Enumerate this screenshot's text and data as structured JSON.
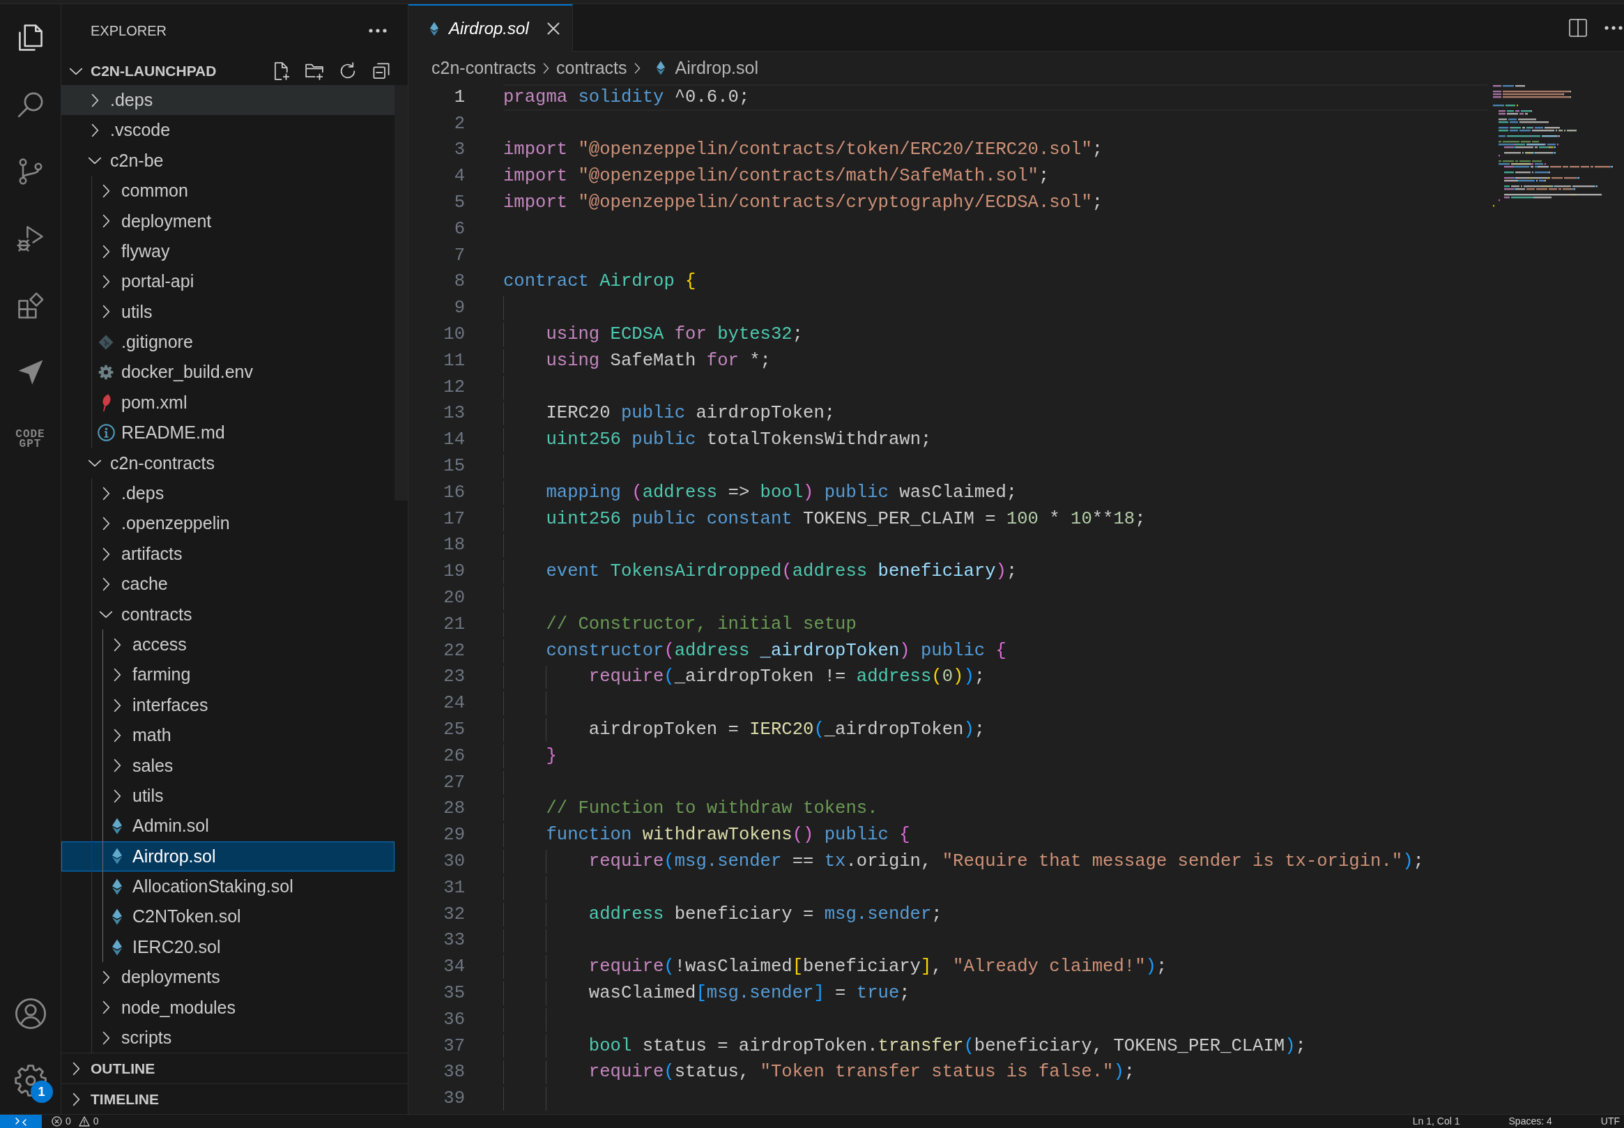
{
  "activity_bar": {
    "items": [
      {
        "kind": "explorer",
        "selected": true
      },
      {
        "kind": "search",
        "selected": false
      },
      {
        "kind": "source-control",
        "selected": false
      },
      {
        "kind": "run-debug",
        "selected": false
      },
      {
        "kind": "extensions",
        "selected": false
      },
      {
        "kind": "send",
        "selected": false
      },
      {
        "kind": "text-logo",
        "label": "CODE GPT",
        "selected": false
      }
    ],
    "bottom_items": [
      {
        "kind": "account"
      },
      {
        "kind": "settings",
        "badge": "1"
      }
    ]
  },
  "sidebar": {
    "title": "EXPLORER",
    "sections": [
      {
        "title": "C2N-LAUNCHPAD",
        "kind": "workspace",
        "expanded": true,
        "tree": [
          {
            "label": ".deps",
            "kind": "folder",
            "expanded": false,
            "hovered": true,
            "selected": false
          },
          {
            "label": ".vscode",
            "kind": "folder",
            "expanded": false,
            "hovered": false,
            "selected": false
          },
          {
            "label": "c2n-be",
            "kind": "folder",
            "expanded": true,
            "hovered": false,
            "selected": false,
            "children": [
              {
                "label": "common",
                "kind": "folder",
                "expanded": false,
                "hovered": false,
                "selected": false
              },
              {
                "label": "deployment",
                "kind": "folder",
                "expanded": false,
                "hovered": false,
                "selected": false
              },
              {
                "label": "flyway",
                "kind": "folder",
                "expanded": false,
                "hovered": false,
                "selected": false
              },
              {
                "label": "portal-api",
                "kind": "folder",
                "expanded": false,
                "hovered": false,
                "selected": false
              },
              {
                "label": "utils",
                "kind": "folder",
                "expanded": false,
                "hovered": false,
                "selected": false
              },
              {
                "label": ".gitignore",
                "kind": "gitignore",
                "hovered": false,
                "selected": false
              },
              {
                "label": "docker_build.env",
                "kind": "env",
                "hovered": false,
                "selected": false
              },
              {
                "label": "pom.xml",
                "kind": "xml",
                "hovered": false,
                "selected": false
              },
              {
                "label": "README.md",
                "kind": "markdown",
                "hovered": false,
                "selected": false
              }
            ]
          },
          {
            "label": "c2n-contracts",
            "kind": "folder",
            "expanded": true,
            "hovered": false,
            "selected": false,
            "children": [
              {
                "label": ".deps",
                "kind": "folder",
                "expanded": false,
                "hovered": false,
                "selected": false
              },
              {
                "label": ".openzeppelin",
                "kind": "folder",
                "expanded": false,
                "hovered": false,
                "selected": false
              },
              {
                "label": "artifacts",
                "kind": "folder",
                "expanded": false,
                "hovered": false,
                "selected": false
              },
              {
                "label": "cache",
                "kind": "folder",
                "expanded": false,
                "hovered": false,
                "selected": false
              },
              {
                "label": "contracts",
                "kind": "folder",
                "expanded": true,
                "hovered": false,
                "selected": false,
                "children": [
                  {
                    "label": "access",
                    "kind": "folder",
                    "expanded": false,
                    "hovered": false,
                    "selected": false
                  },
                  {
                    "label": "farming",
                    "kind": "folder",
                    "expanded": false,
                    "hovered": false,
                    "selected": false
                  },
                  {
                    "label": "interfaces",
                    "kind": "folder",
                    "expanded": false,
                    "hovered": false,
                    "selected": false
                  },
                  {
                    "label": "math",
                    "kind": "folder",
                    "expanded": false,
                    "hovered": false,
                    "selected": false
                  },
                  {
                    "label": "sales",
                    "kind": "folder",
                    "expanded": false,
                    "hovered": false,
                    "selected": false
                  },
                  {
                    "label": "utils",
                    "kind": "folder",
                    "expanded": false,
                    "hovered": false,
                    "selected": false
                  },
                  {
                    "label": "Admin.sol",
                    "kind": "solidity",
                    "hovered": false,
                    "selected": false
                  },
                  {
                    "label": "Airdrop.sol",
                    "kind": "solidity",
                    "hovered": false,
                    "selected": true
                  },
                  {
                    "label": "AllocationStaking.sol",
                    "kind": "solidity",
                    "hovered": false,
                    "selected": false
                  },
                  {
                    "label": "C2NToken.sol",
                    "kind": "solidity",
                    "hovered": false,
                    "selected": false
                  },
                  {
                    "label": "IERC20.sol",
                    "kind": "solidity",
                    "hovered": false,
                    "selected": false
                  }
                ]
              },
              {
                "label": "deployments",
                "kind": "folder",
                "expanded": false,
                "hovered": false,
                "selected": false
              },
              {
                "label": "node_modules",
                "kind": "folder",
                "expanded": false,
                "hovered": false,
                "selected": false
              },
              {
                "label": "scripts",
                "kind": "folder",
                "expanded": false,
                "hovered": false,
                "selected": false
              }
            ]
          }
        ]
      },
      {
        "title": "OUTLINE",
        "kind": "view",
        "expanded": false
      },
      {
        "title": "TIMELINE",
        "kind": "view",
        "expanded": false
      }
    ]
  },
  "editor": {
    "tabs": [
      {
        "label": "Airdrop.sol",
        "kind": "solidity",
        "selected": true,
        "preview": true
      }
    ],
    "breadcrumbs": [
      {
        "label": "c2n-contracts",
        "kind": "folder"
      },
      {
        "label": "contracts",
        "kind": "folder"
      },
      {
        "label": "Airdrop.sol",
        "kind": "solidity"
      }
    ],
    "lines": [
      {
        "number": "1",
        "current": true,
        "tokens": [
          {
            "kind": "control",
            "text": "pragma"
          },
          {
            "kind": "keyword",
            "text": " solidity"
          },
          {
            "kind": "text",
            "text": " ^0.6.0;"
          }
        ]
      },
      {
        "number": "2",
        "current": false
      },
      {
        "number": "3",
        "current": false,
        "tokens": [
          {
            "kind": "control",
            "text": "import"
          },
          {
            "kind": "string",
            "text": " \"@openzeppelin/contracts/token/ERC20/IERC20.sol\""
          },
          {
            "kind": "text",
            "text": ";"
          }
        ]
      },
      {
        "number": "4",
        "current": false,
        "tokens": [
          {
            "kind": "control",
            "text": "import"
          },
          {
            "kind": "string",
            "text": " \"@openzeppelin/contracts/math/SafeMath.sol\""
          },
          {
            "kind": "text",
            "text": ";"
          }
        ]
      },
      {
        "number": "5",
        "current": false,
        "tokens": [
          {
            "kind": "control",
            "text": "import"
          },
          {
            "kind": "string",
            "text": " \"@openzeppelin/contracts/cryptography/ECDSA.sol\""
          },
          {
            "kind": "text",
            "text": ";"
          }
        ]
      },
      {
        "number": "6",
        "current": false
      },
      {
        "number": "7",
        "current": false
      },
      {
        "number": "8",
        "current": false,
        "tokens": [
          {
            "kind": "keyword",
            "text": "contract"
          },
          {
            "kind": "type",
            "text": " Airdrop"
          },
          {
            "kind": "bracket1",
            "text": " {"
          }
        ]
      },
      {
        "number": "9",
        "current": false
      },
      {
        "number": "10",
        "current": false,
        "tokens": [
          {
            "kind": "control",
            "text": "    using"
          },
          {
            "kind": "type",
            "text": " ECDSA"
          },
          {
            "kind": "control",
            "text": " for"
          },
          {
            "kind": "type",
            "text": " bytes32"
          },
          {
            "kind": "text",
            "text": ";"
          }
        ]
      },
      {
        "number": "11",
        "current": false,
        "tokens": [
          {
            "kind": "control",
            "text": "    using"
          },
          {
            "kind": "text",
            "text": " SafeMath"
          },
          {
            "kind": "control",
            "text": " for"
          },
          {
            "kind": "text",
            "text": " *;"
          }
        ]
      },
      {
        "number": "12",
        "current": false
      },
      {
        "number": "13",
        "current": false,
        "tokens": [
          {
            "kind": "text",
            "text": "    IERC20"
          },
          {
            "kind": "keyword",
            "text": " public"
          },
          {
            "kind": "text",
            "text": " airdropToken;"
          }
        ]
      },
      {
        "number": "14",
        "current": false,
        "tokens": [
          {
            "kind": "type",
            "text": "    uint256"
          },
          {
            "kind": "keyword",
            "text": " public"
          },
          {
            "kind": "text",
            "text": " totalTokensWithdrawn;"
          }
        ]
      },
      {
        "number": "15",
        "current": false
      },
      {
        "number": "16",
        "current": false,
        "tokens": [
          {
            "kind": "keyword",
            "text": "    mapping"
          },
          {
            "kind": "bracket2",
            "text": " ("
          },
          {
            "kind": "type",
            "text": "address"
          },
          {
            "kind": "text",
            "text": " => "
          },
          {
            "kind": "type",
            "text": "bool"
          },
          {
            "kind": "bracket2",
            "text": ")"
          },
          {
            "kind": "keyword",
            "text": " public"
          },
          {
            "kind": "text",
            "text": " wasClaimed;"
          }
        ]
      },
      {
        "number": "17",
        "current": false,
        "tokens": [
          {
            "kind": "type",
            "text": "    uint256"
          },
          {
            "kind": "keyword",
            "text": " public"
          },
          {
            "kind": "keyword",
            "text": " constant"
          },
          {
            "kind": "text",
            "text": " TOKENS_PER_CLAIM = "
          },
          {
            "kind": "number",
            "text": "100"
          },
          {
            "kind": "text",
            "text": " * "
          },
          {
            "kind": "number",
            "text": "10"
          },
          {
            "kind": "text",
            "text": "**"
          },
          {
            "kind": "number",
            "text": "18"
          },
          {
            "kind": "text",
            "text": ";"
          }
        ]
      },
      {
        "number": "18",
        "current": false
      },
      {
        "number": "19",
        "current": false,
        "tokens": [
          {
            "kind": "keyword",
            "text": "    event"
          },
          {
            "kind": "type",
            "text": " TokensAirdropped"
          },
          {
            "kind": "bracket2",
            "text": "("
          },
          {
            "kind": "type",
            "text": "address"
          },
          {
            "kind": "parameter",
            "text": " beneficiary"
          },
          {
            "kind": "bracket2",
            "text": ")"
          },
          {
            "kind": "text",
            "text": ";"
          }
        ]
      },
      {
        "number": "20",
        "current": false
      },
      {
        "number": "21",
        "current": false,
        "tokens": [
          {
            "kind": "comment",
            "text": "    // Constructor, initial setup"
          }
        ]
      },
      {
        "number": "22",
        "current": false,
        "tokens": [
          {
            "kind": "keyword",
            "text": "    constructor"
          },
          {
            "kind": "bracket2",
            "text": "("
          },
          {
            "kind": "type",
            "text": "address"
          },
          {
            "kind": "parameter",
            "text": " _airdropToken"
          },
          {
            "kind": "bracket2",
            "text": ")"
          },
          {
            "kind": "keyword",
            "text": " public"
          },
          {
            "kind": "bracket2",
            "text": " {"
          }
        ]
      },
      {
        "number": "23",
        "current": false,
        "tokens": [
          {
            "kind": "control",
            "text": "        require"
          },
          {
            "kind": "bracket3",
            "text": "("
          },
          {
            "kind": "text",
            "text": "_airdropToken != "
          },
          {
            "kind": "type",
            "text": "address"
          },
          {
            "kind": "bracket1",
            "text": "("
          },
          {
            "kind": "number",
            "text": "0"
          },
          {
            "kind": "bracket1",
            "text": ")"
          },
          {
            "kind": "bracket3",
            "text": ")"
          },
          {
            "kind": "text",
            "text": ";"
          }
        ]
      },
      {
        "number": "24",
        "current": false
      },
      {
        "number": "25",
        "current": false,
        "tokens": [
          {
            "kind": "text",
            "text": "        airdropToken = "
          },
          {
            "kind": "function",
            "text": "IERC20"
          },
          {
            "kind": "bracket3",
            "text": "("
          },
          {
            "kind": "text",
            "text": "_airdropToken"
          },
          {
            "kind": "bracket3",
            "text": ")"
          },
          {
            "kind": "text",
            "text": ";"
          }
        ]
      },
      {
        "number": "26",
        "current": false,
        "tokens": [
          {
            "kind": "bracket2",
            "text": "    }"
          }
        ]
      },
      {
        "number": "27",
        "current": false
      },
      {
        "number": "28",
        "current": false,
        "tokens": [
          {
            "kind": "comment",
            "text": "    // Function to withdraw tokens."
          }
        ]
      },
      {
        "number": "29",
        "current": false,
        "tokens": [
          {
            "kind": "keyword",
            "text": "    function"
          },
          {
            "kind": "function",
            "text": " withdrawTokens"
          },
          {
            "kind": "bracket2",
            "text": "()"
          },
          {
            "kind": "keyword",
            "text": " public"
          },
          {
            "kind": "bracket2",
            "text": " {"
          }
        ]
      },
      {
        "number": "30",
        "current": false,
        "tokens": [
          {
            "kind": "control",
            "text": "        require"
          },
          {
            "kind": "bracket3",
            "text": "("
          },
          {
            "kind": "keyword",
            "text": "msg.sender"
          },
          {
            "kind": "text",
            "text": " == "
          },
          {
            "kind": "keyword",
            "text": "tx"
          },
          {
            "kind": "text",
            "text": ".origin, "
          },
          {
            "kind": "string",
            "text": "\"Require that message sender is tx-origin.\""
          },
          {
            "kind": "bracket3",
            "text": ")"
          },
          {
            "kind": "text",
            "text": ";"
          }
        ]
      },
      {
        "number": "31",
        "current": false
      },
      {
        "number": "32",
        "current": false,
        "tokens": [
          {
            "kind": "type",
            "text": "        address"
          },
          {
            "kind": "text",
            "text": " beneficiary = "
          },
          {
            "kind": "keyword",
            "text": "msg.sender"
          },
          {
            "kind": "text",
            "text": ";"
          }
        ]
      },
      {
        "number": "33",
        "current": false
      },
      {
        "number": "34",
        "current": false,
        "tokens": [
          {
            "kind": "control",
            "text": "        require"
          },
          {
            "kind": "bracket3",
            "text": "("
          },
          {
            "kind": "text",
            "text": "!wasClaimed"
          },
          {
            "kind": "bracket1",
            "text": "["
          },
          {
            "kind": "text",
            "text": "beneficiary"
          },
          {
            "kind": "bracket1",
            "text": "]"
          },
          {
            "kind": "text",
            "text": ", "
          },
          {
            "kind": "string",
            "text": "\"Already claimed!\""
          },
          {
            "kind": "bracket3",
            "text": ")"
          },
          {
            "kind": "text",
            "text": ";"
          }
        ]
      },
      {
        "number": "35",
        "current": false,
        "tokens": [
          {
            "kind": "text",
            "text": "        wasClaimed"
          },
          {
            "kind": "bracket3",
            "text": "["
          },
          {
            "kind": "keyword",
            "text": "msg.sender"
          },
          {
            "kind": "bracket3",
            "text": "]"
          },
          {
            "kind": "text",
            "text": " = "
          },
          {
            "kind": "keyword",
            "text": "true"
          },
          {
            "kind": "text",
            "text": ";"
          }
        ]
      },
      {
        "number": "36",
        "current": false
      },
      {
        "number": "37",
        "current": false,
        "tokens": [
          {
            "kind": "type",
            "text": "        bool"
          },
          {
            "kind": "text",
            "text": " status = airdropToken."
          },
          {
            "kind": "function",
            "text": "transfer"
          },
          {
            "kind": "bracket3",
            "text": "("
          },
          {
            "kind": "text",
            "text": "beneficiary, TOKENS_PER_CLAIM"
          },
          {
            "kind": "bracket3",
            "text": ")"
          },
          {
            "kind": "text",
            "text": ";"
          }
        ]
      },
      {
        "number": "38",
        "current": false,
        "tokens": [
          {
            "kind": "control",
            "text": "        require"
          },
          {
            "kind": "bracket3",
            "text": "("
          },
          {
            "kind": "text",
            "text": "status, "
          },
          {
            "kind": "string",
            "text": "\"Token transfer status is false.\""
          },
          {
            "kind": "bracket3",
            "text": ")"
          },
          {
            "kind": "text",
            "text": ";"
          }
        ]
      },
      {
        "number": "39",
        "current": false
      }
    ]
  },
  "status_bar": {
    "problems": {
      "errors": "0",
      "warnings": "0"
    },
    "items": [
      "Ln 1, Col 1",
      "Spaces: 4",
      "UTF"
    ]
  }
}
